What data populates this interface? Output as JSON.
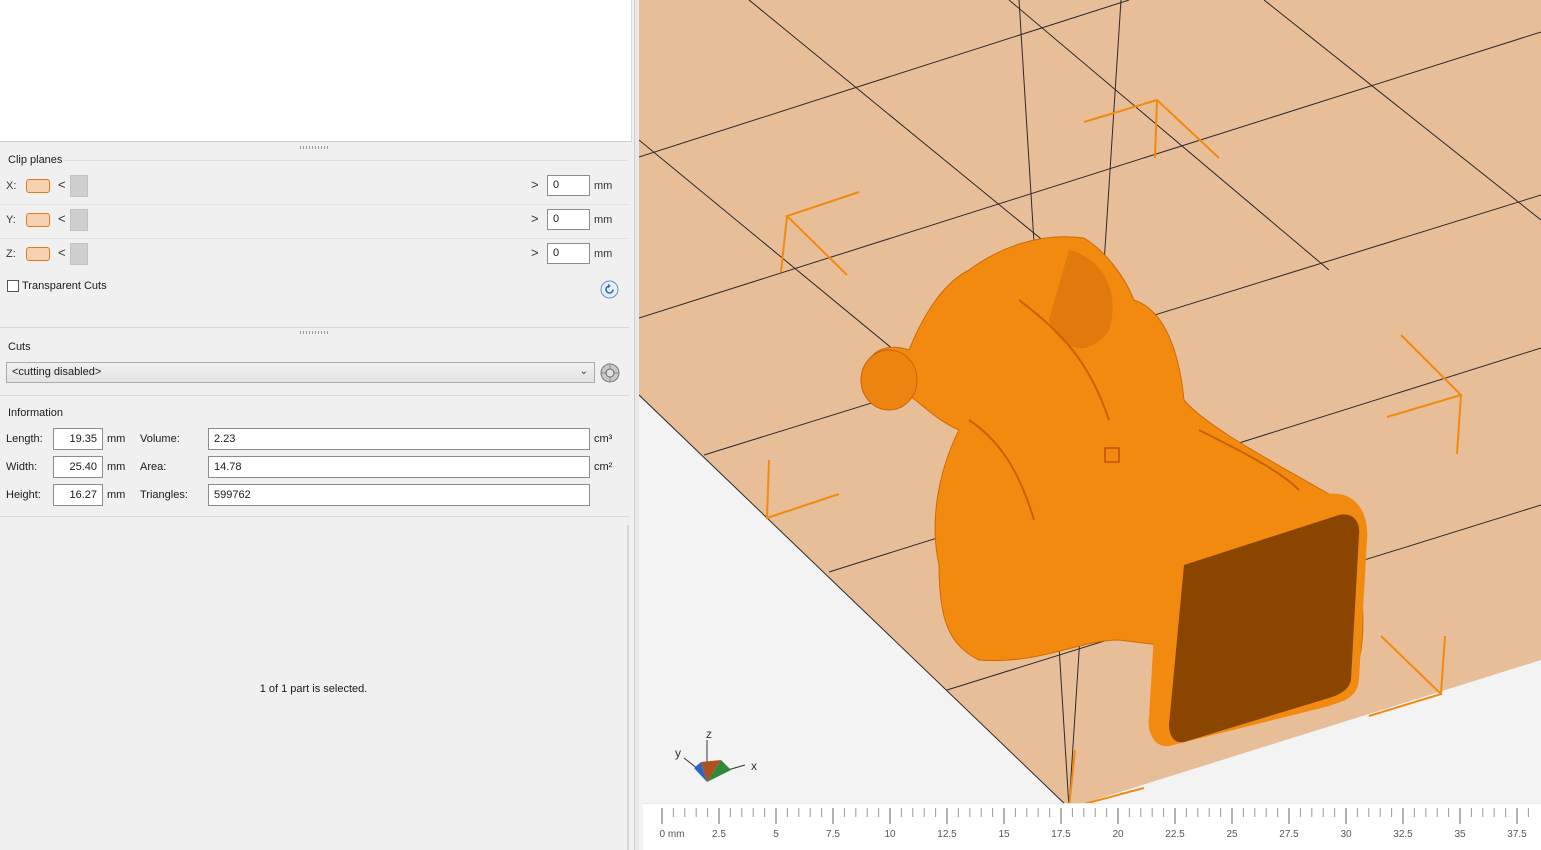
{
  "clip_planes": {
    "title": "Clip planes",
    "rows": [
      {
        "axis": "X:",
        "value": "0",
        "unit": "mm"
      },
      {
        "axis": "Y:",
        "value": "0",
        "unit": "mm"
      },
      {
        "axis": "Z:",
        "value": "0",
        "unit": "mm"
      }
    ],
    "left_arrow": "<",
    "right_arrow": ">",
    "transparent_cuts_label": "Transparent Cuts"
  },
  "cuts": {
    "title": "Cuts",
    "selected": "<cutting disabled>"
  },
  "information": {
    "title": "Information",
    "length_label": "Length:",
    "length_value": "19.35",
    "length_unit": "mm",
    "width_label": "Width:",
    "width_value": "25.40",
    "width_unit": "mm",
    "height_label": "Height:",
    "height_value": "16.27",
    "height_unit": "mm",
    "volume_label": "Volume:",
    "volume_value": "2.23",
    "volume_unit": "cm³",
    "area_label": "Area:",
    "area_value": "14.78",
    "area_unit": "cm²",
    "triangles_label": "Triangles:",
    "triangles_value": "599762"
  },
  "status_text": "1 of 1 part is selected.",
  "viewport": {
    "axis_labels": {
      "x": "x",
      "y": "y",
      "z": "z"
    },
    "model_color": "#f28a10",
    "plate_color": "#e8be98"
  },
  "ruler": {
    "labels": [
      "0 mm",
      "2.5",
      "5",
      "7.5",
      "10",
      "12.5",
      "15",
      "17.5",
      "20",
      "22.5",
      "25",
      "27.5",
      "30",
      "32.5",
      "35",
      "37.5"
    ]
  }
}
